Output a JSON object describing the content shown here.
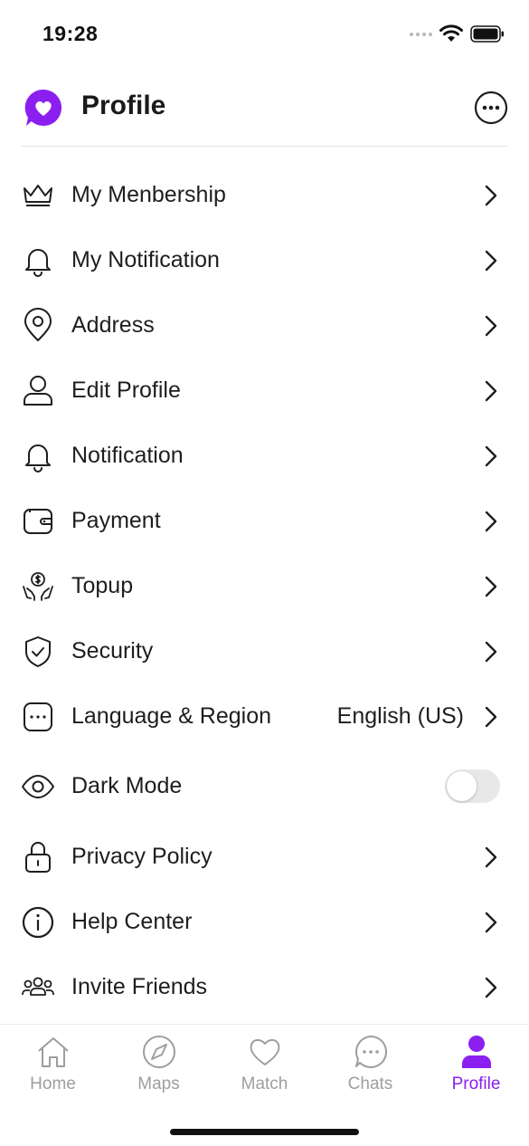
{
  "status_bar": {
    "time": "19:28"
  },
  "header": {
    "title": "Profile"
  },
  "menu": {
    "items": [
      {
        "label": "My Menbership",
        "icon": "crown-icon"
      },
      {
        "label": "My Notification",
        "icon": "bell-icon"
      },
      {
        "label": "Address",
        "icon": "location-pin-icon"
      },
      {
        "label": "Edit Profile",
        "icon": "user-icon"
      },
      {
        "label": "Notification",
        "icon": "bell-icon"
      },
      {
        "label": "Payment",
        "icon": "wallet-icon"
      },
      {
        "label": "Topup",
        "icon": "money-hands-icon"
      },
      {
        "label": "Security",
        "icon": "shield-check-icon"
      },
      {
        "label": "Language & Region",
        "value": "English (US)",
        "icon": "chat-dots-icon"
      },
      {
        "label": "Dark Mode",
        "icon": "eye-icon",
        "toggle_on": false
      },
      {
        "label": "Privacy Policy",
        "icon": "lock-icon"
      },
      {
        "label": "Help Center",
        "icon": "info-circle-icon"
      },
      {
        "label": "Invite Friends",
        "icon": "people-icon"
      }
    ]
  },
  "tabs": [
    {
      "label": "Home",
      "icon": "home-icon",
      "active": false
    },
    {
      "label": "Maps",
      "icon": "compass-icon",
      "active": false
    },
    {
      "label": "Match",
      "icon": "heart-icon",
      "active": false
    },
    {
      "label": "Chats",
      "icon": "chat-bubble-icon",
      "active": false
    },
    {
      "label": "Profile",
      "icon": "profile-person-icon",
      "active": true
    }
  ],
  "colors": {
    "accent": "#8a1ff0",
    "text": "#1e1e1e",
    "inactive_tab": "#9e9e9e",
    "divider": "#e4e4e4"
  }
}
